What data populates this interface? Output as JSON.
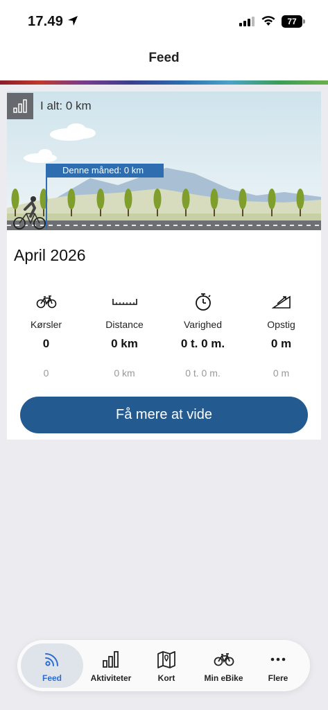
{
  "status_bar": {
    "time": "17.49",
    "battery": "77"
  },
  "header": {
    "title": "Feed"
  },
  "card": {
    "total_label": "I alt: 0 km",
    "month_flag": "Denne måned: 0 km",
    "month_title": "April 2026",
    "stats": [
      {
        "icon": "bicycle-icon",
        "label": "Kørsler",
        "value": "0",
        "previous": "0"
      },
      {
        "icon": "ruler-icon",
        "label": "Distance",
        "value": "0 km",
        "previous": "0 km"
      },
      {
        "icon": "stopwatch-icon",
        "label": "Varighed",
        "value": "0 t. 0 m.",
        "previous": "0 t. 0 m."
      },
      {
        "icon": "incline-icon",
        "label": "Opstig",
        "value": "0 m",
        "previous": "0 m"
      }
    ],
    "learn_more_label": "Få mere at vide"
  },
  "bottom_nav": {
    "items": [
      {
        "label": "Feed",
        "icon": "feed-icon",
        "active": true
      },
      {
        "label": "Aktiviteter",
        "icon": "bar-chart-icon"
      },
      {
        "label": "Kort",
        "icon": "map-icon"
      },
      {
        "label": "Min eBike",
        "icon": "ebike-icon"
      },
      {
        "label": "Flere",
        "icon": "more-dots-icon"
      }
    ]
  },
  "colors": {
    "accent_blue": "#235a8f",
    "flag_blue": "#2d6db0",
    "active_nav": "#2b6cd0",
    "background": "#ecebf0"
  }
}
